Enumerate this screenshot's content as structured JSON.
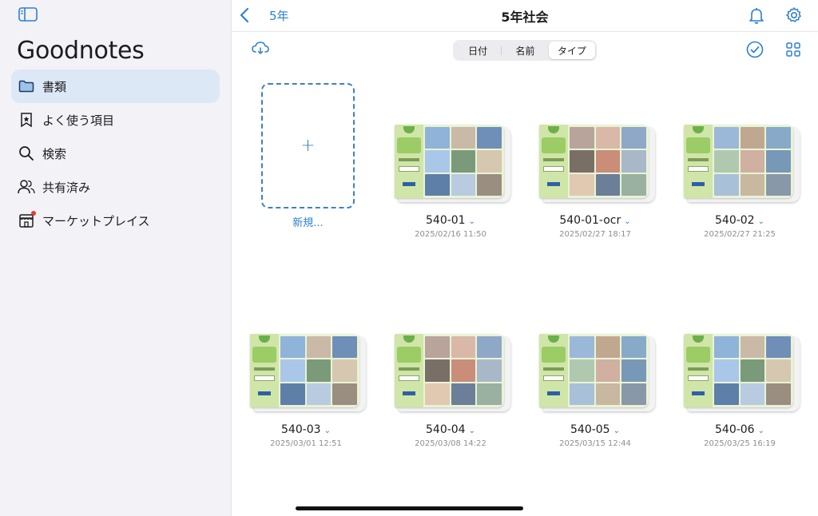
{
  "sidebar": {
    "app_title": "Goodnotes",
    "items": [
      {
        "label": "書類",
        "icon": "folder-icon",
        "active": true
      },
      {
        "label": "よく使う項目",
        "icon": "bookmark-star-icon",
        "active": false
      },
      {
        "label": "検索",
        "icon": "search-icon",
        "active": false
      },
      {
        "label": "共有済み",
        "icon": "shared-people-icon",
        "active": false
      },
      {
        "label": "マーケットプレイス",
        "icon": "store-icon",
        "active": false,
        "badge": "dot"
      }
    ]
  },
  "header": {
    "back_label": "5年",
    "title": "5年社会"
  },
  "toolbar": {
    "sort_options": [
      "日付",
      "名前",
      "タイプ"
    ],
    "selected_sort": "タイプ"
  },
  "new_document": {
    "plus": "+",
    "label": "新規..."
  },
  "documents": [
    {
      "name": "540-01",
      "date": "2025/02/16 11:50"
    },
    {
      "name": "540-01-ocr",
      "date": "2025/02/27 18:17"
    },
    {
      "name": "540-02",
      "date": "2025/02/27 21:25"
    },
    {
      "name": "540-03",
      "date": "2025/03/01 12:51"
    },
    {
      "name": "540-04",
      "date": "2025/03/08 14:22"
    },
    {
      "name": "540-05",
      "date": "2025/03/15 12:44"
    },
    {
      "name": "540-06",
      "date": "2025/03/25 16:19"
    }
  ],
  "colors": {
    "accent": "#2f7fd1",
    "sidebar_bg": "#f2f2f7",
    "active_item_bg": "#dde8f6",
    "badge_red": "#e53935"
  }
}
